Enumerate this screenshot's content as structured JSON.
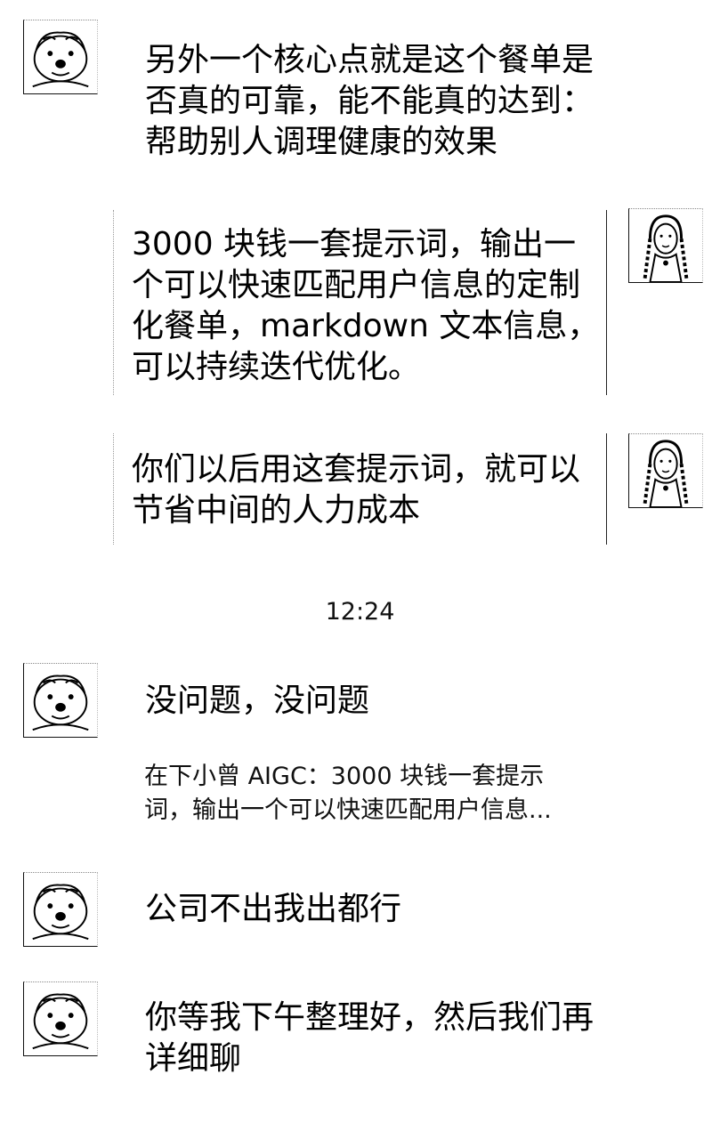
{
  "messages": [
    {
      "sender": "left",
      "text": "另外一个核心点就是这个餐单是\n否真的可靠，能不能真的达到：\n帮助别人调理健康的效果"
    },
    {
      "sender": "right",
      "text": "3000 块钱一套提示词，输出一\n个可以快速匹配用户信息的定制\n化餐单，markdown 文本信息，\n可以持续迭代优化。"
    },
    {
      "sender": "right",
      "text": "你们以后用这套提示词，就可以\n节省中间的人力成本"
    },
    {
      "sender": "left",
      "text": "没问题，没问题"
    },
    {
      "sender": "left",
      "text": "公司不出我出都行"
    },
    {
      "sender": "left",
      "text": "你等我下午整理好，然后我们再\n详细聊"
    }
  ],
  "timestamp": "12:24",
  "quote": {
    "text": "在下小曾 AIGC：3000 块钱一套提示\n词，输出一个可以快速匹配用户信息..."
  },
  "avatars": {
    "left_icon": "dog-avatar-icon",
    "right_icon": "woman-avatar-icon"
  }
}
